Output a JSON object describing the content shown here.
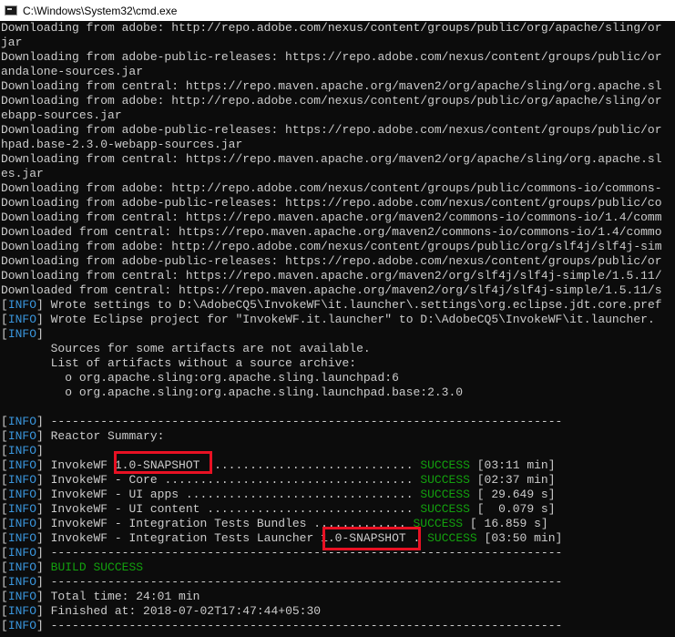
{
  "window": {
    "title": "C:\\Windows\\System32\\cmd.exe"
  },
  "colors": {
    "background": "#0c0c0c",
    "text": "#cccccc",
    "info_tag": "#3a96dd",
    "success": "#13a10e",
    "highlight_box": "#e81123"
  },
  "console": {
    "lines": [
      [
        {
          "t": "Downloading from adobe: http://repo.adobe.com/nexus/content/groups/public/org/apache/sling/or"
        }
      ],
      [
        {
          "t": "jar"
        }
      ],
      [
        {
          "t": "Downloading from adobe-public-releases: https://repo.adobe.com/nexus/content/groups/public/or"
        }
      ],
      [
        {
          "t": "andalone-sources.jar"
        }
      ],
      [
        {
          "t": "Downloading from central: https://repo.maven.apache.org/maven2/org/apache/sling/org.apache.sl"
        }
      ],
      [
        {
          "t": "Downloading from adobe: http://repo.adobe.com/nexus/content/groups/public/org/apache/sling/or"
        }
      ],
      [
        {
          "t": "ebapp-sources.jar"
        }
      ],
      [
        {
          "t": "Downloading from adobe-public-releases: https://repo.adobe.com/nexus/content/groups/public/or"
        }
      ],
      [
        {
          "t": "hpad.base-2.3.0-webapp-sources.jar"
        }
      ],
      [
        {
          "t": "Downloading from central: https://repo.maven.apache.org/maven2/org/apache/sling/org.apache.sl"
        }
      ],
      [
        {
          "t": "es.jar"
        }
      ],
      [
        {
          "t": "Downloading from adobe: http://repo.adobe.com/nexus/content/groups/public/commons-io/commons-"
        }
      ],
      [
        {
          "t": "Downloading from adobe-public-releases: https://repo.adobe.com/nexus/content/groups/public/co"
        }
      ],
      [
        {
          "t": "Downloading from central: https://repo.maven.apache.org/maven2/commons-io/commons-io/1.4/comm"
        }
      ],
      [
        {
          "t": "Downloaded from central: https://repo.maven.apache.org/maven2/commons-io/commons-io/1.4/commo"
        }
      ],
      [
        {
          "t": "Downloading from adobe: http://repo.adobe.com/nexus/content/groups/public/org/slf4j/slf4j-sim"
        }
      ],
      [
        {
          "t": "Downloading from adobe-public-releases: https://repo.adobe.com/nexus/content/groups/public/or"
        }
      ],
      [
        {
          "t": "Downloading from central: https://repo.maven.apache.org/maven2/org/slf4j/slf4j-simple/1.5.11/"
        }
      ],
      [
        {
          "t": "Downloaded from central: https://repo.maven.apache.org/maven2/org/slf4j/slf4j-simple/1.5.11/s"
        }
      ],
      [
        {
          "t": "[",
          "c": ""
        },
        {
          "t": "INFO",
          "c": "info"
        },
        {
          "t": "] Wrote settings to D:\\AdobeCQ5\\InvokeWF\\it.launcher\\.settings\\org.eclipse.jdt.core.pref"
        }
      ],
      [
        {
          "t": "[",
          "c": ""
        },
        {
          "t": "INFO",
          "c": "info"
        },
        {
          "t": "] Wrote Eclipse project for \"InvokeWF.it.launcher\" to D:\\AdobeCQ5\\InvokeWF\\it.launcher."
        }
      ],
      [
        {
          "t": "[",
          "c": ""
        },
        {
          "t": "INFO",
          "c": "info"
        },
        {
          "t": "]"
        }
      ],
      [
        {
          "t": "       Sources for some artifacts are not available."
        }
      ],
      [
        {
          "t": "       List of artifacts without a source archive:"
        }
      ],
      [
        {
          "t": "         o org.apache.sling:org.apache.sling.launchpad:6"
        }
      ],
      [
        {
          "t": "         o org.apache.sling:org.apache.sling.launchpad.base:2.3.0"
        }
      ],
      [
        {
          "t": ""
        }
      ],
      [
        {
          "t": "[",
          "c": ""
        },
        {
          "t": "INFO",
          "c": "info"
        },
        {
          "t": "] ------------------------------------------------------------------------"
        }
      ],
      [
        {
          "t": "[",
          "c": ""
        },
        {
          "t": "INFO",
          "c": "info"
        },
        {
          "t": "] Reactor Summary:"
        }
      ],
      [
        {
          "t": "[",
          "c": ""
        },
        {
          "t": "INFO",
          "c": "info"
        },
        {
          "t": "]"
        }
      ],
      [
        {
          "t": "[",
          "c": ""
        },
        {
          "t": "INFO",
          "c": "info"
        },
        {
          "t": "] InvokeWF 1.0-SNAPSHOT ............................. "
        },
        {
          "t": "SUCCESS",
          "c": "success"
        },
        {
          "t": " [03:11 min]"
        }
      ],
      [
        {
          "t": "[",
          "c": ""
        },
        {
          "t": "INFO",
          "c": "info"
        },
        {
          "t": "] InvokeWF - Core ................................... "
        },
        {
          "t": "SUCCESS",
          "c": "success"
        },
        {
          "t": " [02:37 min]"
        }
      ],
      [
        {
          "t": "[",
          "c": ""
        },
        {
          "t": "INFO",
          "c": "info"
        },
        {
          "t": "] InvokeWF - UI apps ................................ "
        },
        {
          "t": "SUCCESS",
          "c": "success"
        },
        {
          "t": " [ 29.649 s]"
        }
      ],
      [
        {
          "t": "[",
          "c": ""
        },
        {
          "t": "INFO",
          "c": "info"
        },
        {
          "t": "] InvokeWF - UI content ............................. "
        },
        {
          "t": "SUCCESS",
          "c": "success"
        },
        {
          "t": " [  0.079 s]"
        }
      ],
      [
        {
          "t": "[",
          "c": ""
        },
        {
          "t": "INFO",
          "c": "info"
        },
        {
          "t": "] InvokeWF - Integration Tests Bundles ............. "
        },
        {
          "t": "SUCCESS",
          "c": "success"
        },
        {
          "t": " [ 16.859 s]"
        }
      ],
      [
        {
          "t": "[",
          "c": ""
        },
        {
          "t": "INFO",
          "c": "info"
        },
        {
          "t": "] InvokeWF - Integration Tests Launcher 1.0-SNAPSHOT . "
        },
        {
          "t": "SUCCESS",
          "c": "success"
        },
        {
          "t": " [03:50 min]"
        }
      ],
      [
        {
          "t": "[",
          "c": ""
        },
        {
          "t": "INFO",
          "c": "info"
        },
        {
          "t": "] ------------------------------------------------------------------------"
        }
      ],
      [
        {
          "t": "[",
          "c": ""
        },
        {
          "t": "INFO",
          "c": "info"
        },
        {
          "t": "] "
        },
        {
          "t": "BUILD SUCCESS",
          "c": "success"
        }
      ],
      [
        {
          "t": "[",
          "c": ""
        },
        {
          "t": "INFO",
          "c": "info"
        },
        {
          "t": "] ------------------------------------------------------------------------"
        }
      ],
      [
        {
          "t": "[",
          "c": ""
        },
        {
          "t": "INFO",
          "c": "info"
        },
        {
          "t": "] Total time: 24:01 min"
        }
      ],
      [
        {
          "t": "[",
          "c": ""
        },
        {
          "t": "INFO",
          "c": "info"
        },
        {
          "t": "] Finished at: 2018-07-02T17:47:44+05:30"
        }
      ],
      [
        {
          "t": "[",
          "c": ""
        },
        {
          "t": "INFO",
          "c": "info"
        },
        {
          "t": "] ------------------------------------------------------------------------"
        }
      ]
    ]
  }
}
